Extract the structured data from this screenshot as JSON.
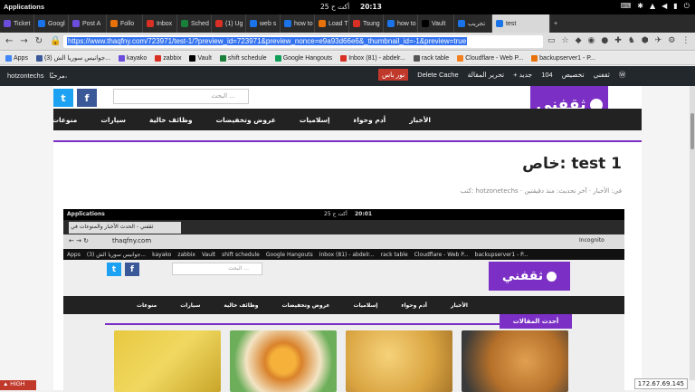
{
  "os": {
    "activities": "Applications",
    "date": "25 أكت ح",
    "time": "20:13"
  },
  "tabs": [
    {
      "label": "Ticket",
      "color": "#6b4cdb"
    },
    {
      "label": "Googl",
      "color": "#1a73e8"
    },
    {
      "label": "Post A",
      "color": "#6b4cdb"
    },
    {
      "label": "Follo",
      "color": "#e8710a"
    },
    {
      "label": "Inbox",
      "color": "#d93025"
    },
    {
      "label": "Sched",
      "color": "#188038"
    },
    {
      "label": "(1) Ug",
      "color": "#d93025"
    },
    {
      "label": "web s",
      "color": "#1a73e8"
    },
    {
      "label": "how to",
      "color": "#1a73e8"
    },
    {
      "label": "Load T",
      "color": "#e8710a"
    },
    {
      "label": "Tsung",
      "color": "#d93025"
    },
    {
      "label": "how to",
      "color": "#1a73e8"
    },
    {
      "label": "Vault",
      "color": "#000000"
    },
    {
      "label": "تجريب",
      "color": "#1a73e8"
    },
    {
      "label": "test",
      "color": "#1a73e8"
    }
  ],
  "address": {
    "url": "https://www.thaqfny.com/723971/test-1/?preview_id=723971&preview_nonce=e9a93d66e6&_thumbnail_id=-1&preview=true"
  },
  "bookmarks": [
    {
      "label": "Apps",
      "color": "#4285f4"
    },
    {
      "label": "(3) جوانيس سوريا الش...",
      "color": "#3b5998"
    },
    {
      "label": "kayako",
      "color": "#6b4cdb"
    },
    {
      "label": "zabbix",
      "color": "#d93025"
    },
    {
      "label": "Vault",
      "color": "#000000"
    },
    {
      "label": "shift schedule",
      "color": "#188038"
    },
    {
      "label": "Google Hangouts",
      "color": "#0f9d58"
    },
    {
      "label": "Inbox (81) - abdelr...",
      "color": "#d93025"
    },
    {
      "label": "rack table",
      "color": "#555555"
    },
    {
      "label": "Cloudflare - Web P...",
      "color": "#f38020"
    },
    {
      "label": "backupserver1 - P...",
      "color": "#e8710a"
    }
  ],
  "wpbar": {
    "user": "hotzontechs",
    "greeting": "مرحبًا،",
    "publish": "نور باس",
    "cache": "Delete Cache",
    "edit": "تحرير المقالة",
    "new": "+ جديد",
    "comments": "104",
    "customize": "تخصيص",
    "site": "ثقفني"
  },
  "site": {
    "logo": "ثقفني",
    "search_placeholder": "البحث ...",
    "nav": [
      "الأخبار",
      "أدم وحواء",
      "إسلاميات",
      "عروض وتخفيضات",
      "وظائف خالية",
      "سيارات",
      "منوعات"
    ]
  },
  "post": {
    "title": "خاص: test 1",
    "meta": "كتب: hotzonetechs · في: الأخبار · آخر تحديث: منذ دقيقتين"
  },
  "inner": {
    "activities": "Applications",
    "date": "25 أكت ح",
    "time": "20:01",
    "tab": "ثقفني - الحدث الأخبار والمنوعات في",
    "url": "thaqfny.com",
    "incognito": "Incognito",
    "latest": "أحدث المقالات",
    "nav": [
      "الأخبار",
      "أدم وحواء",
      "إسلاميات",
      "عروض وتخفيضات",
      "وظائف خالية",
      "سيارات",
      "منوعات"
    ]
  },
  "status": {
    "label": "HIGH"
  },
  "ip": "172.67.69.145"
}
